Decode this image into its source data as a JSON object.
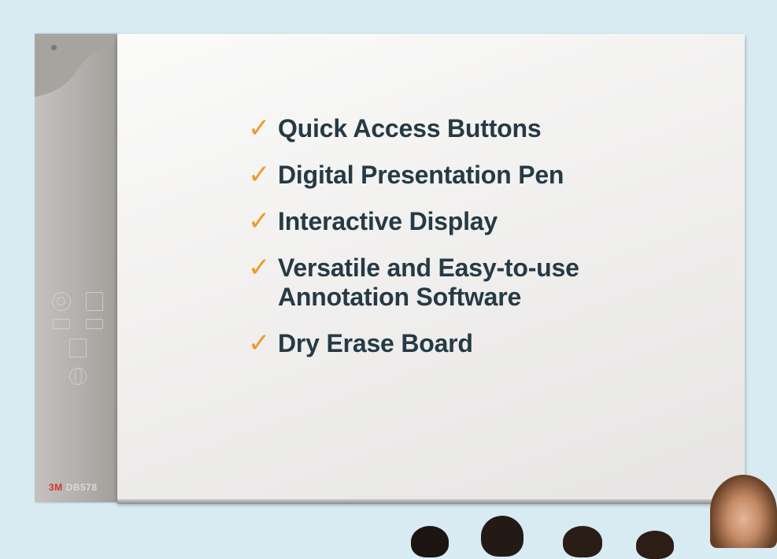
{
  "features": [
    {
      "label": "Quick Access Buttons"
    },
    {
      "label": "Digital Presentation Pen"
    },
    {
      "label": "Interactive Display"
    },
    {
      "label": "Versatile and Easy-to-use Annotation Software",
      "line1": "Versatile and Easy-to-use",
      "line2": "Annotation Software"
    },
    {
      "label": "Dry Erase Board"
    }
  ],
  "check_symbol": "✓",
  "brand": {
    "logo": "3M",
    "model": "DB578"
  },
  "colors": {
    "check": "#f09a2a",
    "text": "#253a45",
    "background": "#d9ecf3",
    "logo": "#d5322c"
  }
}
